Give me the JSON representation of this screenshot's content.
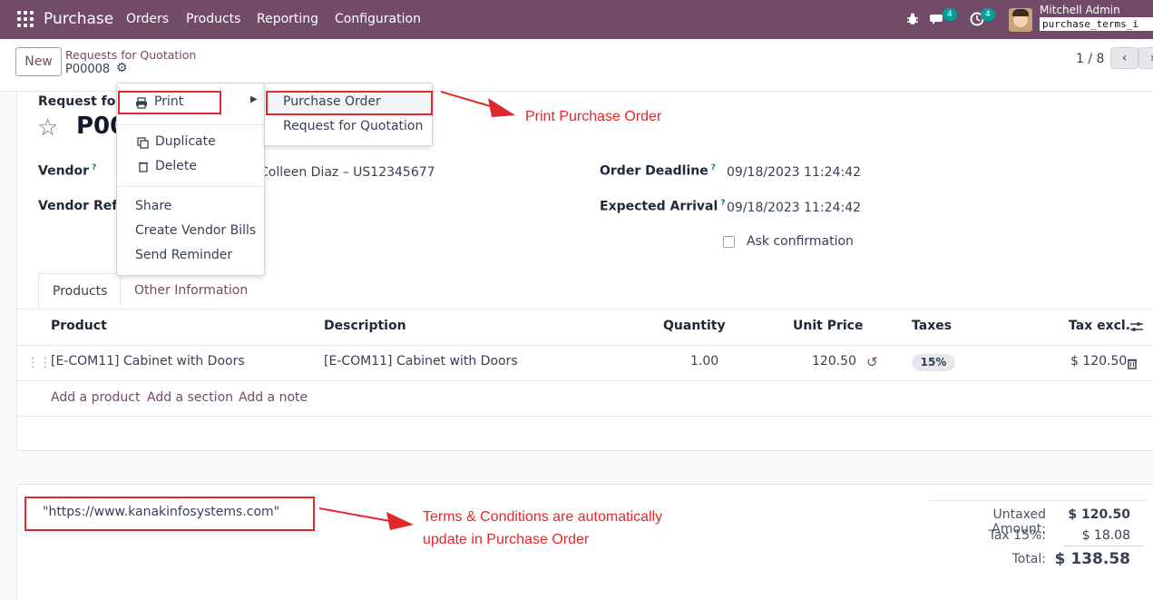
{
  "topbar": {
    "app_name": "Purchase",
    "menus": [
      "Orders",
      "Products",
      "Reporting",
      "Configuration"
    ],
    "messages_count": "4",
    "activities_count": "4",
    "user_name": "Mitchell Admin",
    "database": "purchase_terms_i"
  },
  "control": {
    "new_label": "New",
    "breadcrumb_parent": "Requests for Quotation",
    "record_ref": "P00008",
    "pager_text": "1 / 8"
  },
  "form": {
    "title_label": "Request for Q",
    "record_name": "P00",
    "vendor_label": "Vendor",
    "vendor_value": "Colleen Diaz – US12345677",
    "vendor_ref_label": "Vendor Refer",
    "order_deadline_label": "Order Deadline",
    "order_deadline_value": "09/18/2023 11:24:42",
    "expected_arrival_label": "Expected Arrival",
    "expected_arrival_value": "09/18/2023 11:24:42",
    "ask_confirmation_label": "Ask confirmation",
    "help_mark": "?"
  },
  "tabs": [
    {
      "label": "Products",
      "active": true
    },
    {
      "label": "Other Information",
      "active": false
    }
  ],
  "table": {
    "columns": [
      "Product",
      "Description",
      "Quantity",
      "Unit Price",
      "Taxes",
      "Tax excl."
    ],
    "rows": [
      {
        "product": "[E-COM11] Cabinet with Doors",
        "description": "[E-COM11] Cabinet with Doors",
        "quantity": "1.00",
        "unit_price": "120.50",
        "tax": "15%",
        "subtotal": "$ 120.50"
      }
    ],
    "add_links": [
      "Add a product",
      "Add a section",
      "Add a note"
    ]
  },
  "terms": "\"https://www.kanakinfosystems.com\"",
  "totals": {
    "untaxed_label": "Untaxed Amount:",
    "untaxed_value": "$ 120.50",
    "tax_label": "Tax 15%:",
    "tax_value": "$ 18.08",
    "total_label": "Total:",
    "total_value": "$ 138.58"
  },
  "action_menu": {
    "print_label": "Print",
    "items": [
      "Duplicate",
      "Delete"
    ],
    "items2": [
      "Share",
      "Create Vendor Bills",
      "Send Reminder"
    ],
    "print_submenu": [
      "Purchase Order",
      "Request for Quotation"
    ]
  },
  "annotations": {
    "print_note": "Print Purchase Order",
    "terms_note_line1": "Terms & Conditions are automatically",
    "terms_note_line2": "update in Purchase Order",
    "color": "#e0282c"
  },
  "colors": {
    "brand": "#714b67",
    "badge": "#00a09d",
    "highlight": "#e0282c"
  }
}
